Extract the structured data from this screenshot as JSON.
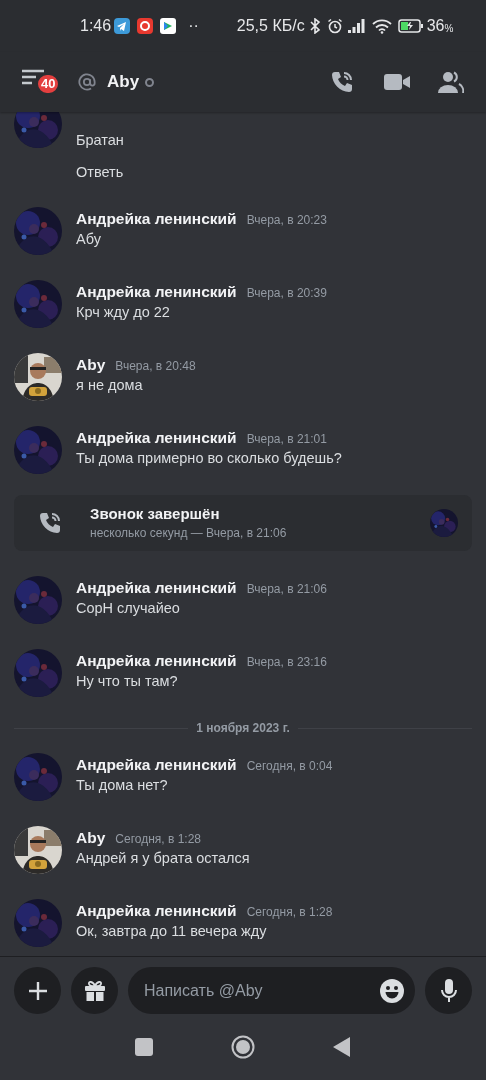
{
  "status_bar": {
    "time": "1:46",
    "more": "··",
    "speed": "25,5 КБ/с",
    "battery": "36",
    "battery_unit": "%"
  },
  "header": {
    "badge": "40",
    "title": "Aby",
    "online": false
  },
  "messages": [
    {
      "kind": "continuation",
      "lines": [
        "Братан",
        "Ответь"
      ]
    },
    {
      "kind": "message",
      "author": "Андрейка ленинский",
      "time": "Вчера, в 20:23",
      "lines": [
        "Абу"
      ]
    },
    {
      "kind": "message",
      "author": "Андрейка ленинский",
      "time": "Вчера, в 20:39",
      "lines": [
        "Крч жду до 22"
      ]
    },
    {
      "kind": "message",
      "author": "Aby",
      "time": "Вчера, в 20:48",
      "lines": [
        "я не дома"
      ]
    },
    {
      "kind": "message",
      "author": "Андрейка ленинский",
      "time": "Вчера, в 21:01",
      "lines": [
        "Ты дома примерно во сколько будешь?"
      ]
    },
    {
      "kind": "call",
      "title": "Звонок завершён",
      "subtitle": "несколько секунд — Вчера, в 21:06"
    },
    {
      "kind": "message",
      "author": "Андрейка ленинский",
      "time": "Вчера, в 21:06",
      "lines": [
        "СорН случайео"
      ]
    },
    {
      "kind": "message",
      "author": "Андрейка ленинский",
      "time": "Вчера, в 23:16",
      "lines": [
        "Ну что ты там?"
      ]
    },
    {
      "kind": "date_divider",
      "label": "1 ноября 2023 г."
    },
    {
      "kind": "message",
      "author": "Андрейка ленинский",
      "time": "Сегодня, в 0:04",
      "lines": [
        "Ты дома нет?"
      ]
    },
    {
      "kind": "message",
      "author": "Aby",
      "time": "Сегодня, в 1:28",
      "lines": [
        "Андрей я у брата остался"
      ]
    },
    {
      "kind": "message",
      "author": "Андрейка ленинский",
      "time": "Сегодня, в 1:28",
      "lines": [
        "Ок, завтра до 11 вечера жду"
      ]
    }
  ],
  "composer": {
    "placeholder": "Написать @Aby"
  }
}
